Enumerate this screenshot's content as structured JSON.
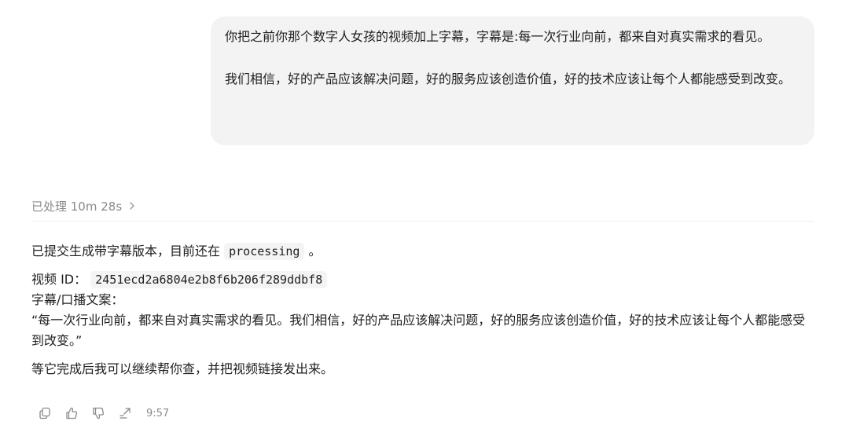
{
  "user_message": {
    "paragraph_1": "你把之前你那个数字人女孩的视频加上字幕，字幕是:每一次行业向前，都来自对真实需求的看见。",
    "paragraph_2": "我们相信，好的产品应该解决问题，好的服务应该创造价值，好的技术应该让每个人都能感受到改变。"
  },
  "processing": {
    "label": "已处理 10m 28s",
    "icon": "chevron-right-icon"
  },
  "reply": {
    "status_prefix": "已提交生成带字幕版本，目前还在",
    "status_code": "processing",
    "status_suffix": "。",
    "video_id_label": "视频 ID：",
    "video_id": "2451ecd2a6804e2b8f6b206f289ddbf8",
    "subtitle_label": "字幕/口播文案：",
    "subtitle_text": "“每一次行业向前，都来自对真实需求的看见。我们相信，好的产品应该解决问题，好的服务应该创造价值，好的技术应该让每个人都能感受到改变。”",
    "closing": "等它完成后我可以继续帮你查，并把视频链接发出来。"
  },
  "actions": {
    "icons": [
      "copy-icon",
      "thumbs-up-icon",
      "thumbs-down-icon",
      "share-icon"
    ],
    "timestamp": "9:57"
  }
}
